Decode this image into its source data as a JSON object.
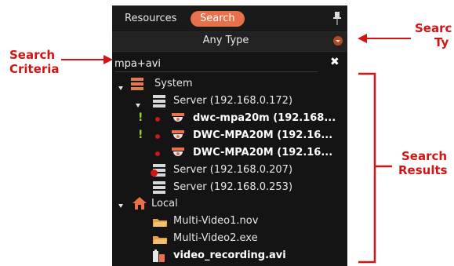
{
  "tabs": {
    "resources": "Resources",
    "search": "Search"
  },
  "type_filter": {
    "label": "Any Type"
  },
  "criteria": {
    "value": "mpa+avi"
  },
  "tree": {
    "system": "System",
    "server1": "Server (192.168.0.172)",
    "cam1": "dwc-mpa20m (192.168...",
    "cam2": "DWC-MPA20M (192.16...",
    "cam3": "DWC-MPA20M (192.16...",
    "server2": "Server (192.168.0.207)",
    "server3": "Server (192.168.0.253)",
    "local": "Local",
    "file1": "Multi-Video1.nov",
    "file2": "Multi-Video2.exe",
    "file3": "video_recording.avi"
  },
  "annotations": {
    "criteria_line1": "Search",
    "criteria_line2": "Criteria",
    "type_line1": "Searc",
    "type_line2": "Ty",
    "results_line1": "Search",
    "results_line2": "Results"
  },
  "colors": {
    "accent": "#e8704a",
    "annotation": "#d11414",
    "panel": "#141414"
  }
}
